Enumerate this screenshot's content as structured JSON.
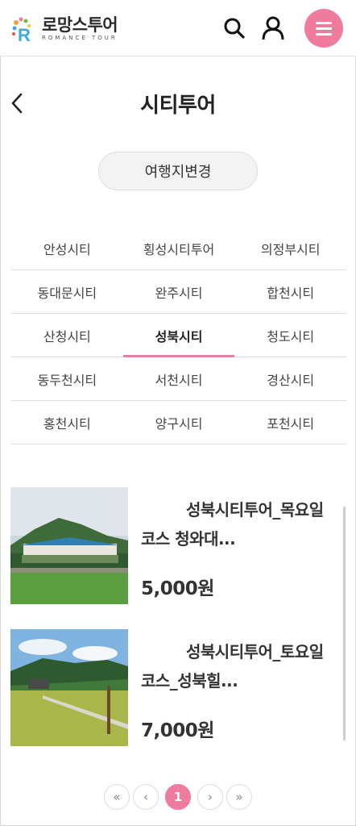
{
  "header": {
    "logo_ko": "로망스투어",
    "logo_en": "ROMANCE TOUR",
    "icons": [
      "search-icon",
      "user-icon",
      "hamburger-menu-icon"
    ],
    "menu_color": "#ef7b9d"
  },
  "page": {
    "title": "시티투어",
    "change_destination_label": "여행지변경"
  },
  "cities": [
    [
      "안성시티",
      "횡성시티투어",
      "의정부시티"
    ],
    [
      "동대문시티",
      "완주시티",
      "합천시티"
    ],
    [
      "산청시티",
      "성북시티",
      "청도시티"
    ],
    [
      "동두천시티",
      "서천시티",
      "경산시티"
    ],
    [
      "홍천시티",
      "양구시티",
      "포천시티"
    ]
  ],
  "active_city": "성북시티",
  "products": [
    {
      "title": "성북시티투어_목요일 코스 청와대...",
      "price": "5,000원"
    },
    {
      "title": "성북시티투어_토요일 코스_성북힐...",
      "price": "7,000원"
    }
  ],
  "pagination": {
    "current_page": "1",
    "first_label": "«",
    "prev_label": "‹",
    "next_label": "›",
    "last_label": "»"
  },
  "colors": {
    "accent": "#ef7b9d",
    "active_underline": "#e87d9d"
  }
}
